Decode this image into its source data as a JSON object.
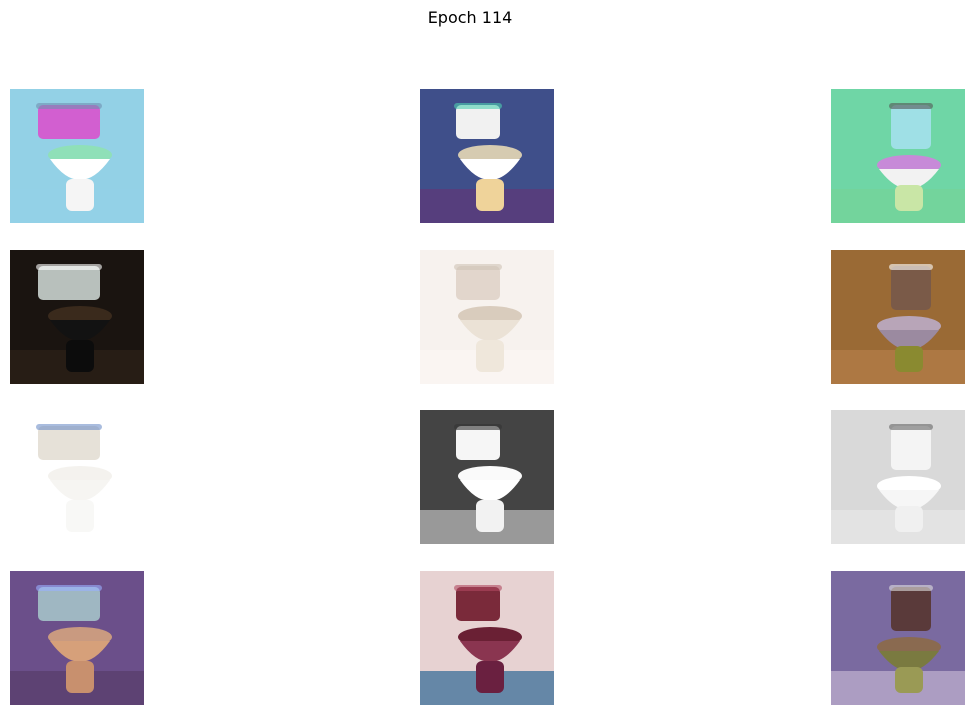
{
  "figure": {
    "title": "Epoch 114"
  },
  "grid": {
    "rows": 4,
    "cols": 3,
    "images": [
      {
        "name": "blue-bg-pink-tank",
        "bg": "#93d1e6",
        "tank": "#d25fd0",
        "lid": "#8fe0b8",
        "bowl": "#ffffff",
        "base": "#f5f5f5",
        "floor": "#93d1e6",
        "accent": "#6f8fb0"
      },
      {
        "name": "mosaic-bg-teal-lid",
        "bg": "#3f4f8a",
        "tank": "#f1f1f1",
        "lid": "#d6cbb1",
        "bowl": "#ffffff",
        "base": "#efd39a",
        "floor": "#5a3b7a",
        "accent": "#4fd1b0"
      },
      {
        "name": "green-bg-cyan-tank",
        "bg": "#6fd6a6",
        "tank": "#9fe0e6",
        "lid": "#c78ad8",
        "bowl": "#f2f2f2",
        "base": "#c9e6a6",
        "floor": "#74d49a",
        "accent": "#555555"
      },
      {
        "name": "dark-bg-black-bowl",
        "bg": "#1a1410",
        "tank": "#b8c0bc",
        "lid": "#3a2a1c",
        "bowl": "#121212",
        "base": "#0c0c0c",
        "floor": "#2a1e16",
        "accent": "#ffffff"
      },
      {
        "name": "white-bg-beige-toilet",
        "bg": "#f7f2ee",
        "tank": "#e2d6cc",
        "lid": "#d9ccbd",
        "bowl": "#ebe2d6",
        "base": "#efe7db",
        "floor": "#faf6f2",
        "accent": "#cfc3b6"
      },
      {
        "name": "brown-bg-glowing-toilet",
        "bg": "#9a6a35",
        "tank": "#7a5a48",
        "lid": "#b8a5b8",
        "bowl": "#9b8aa0",
        "base": "#8a8a30",
        "floor": "#b07a45",
        "accent": "#ffffff"
      },
      {
        "name": "white-bg-faded-toilet",
        "bg": "#ffffff",
        "tank": "#e6e1d8",
        "lid": "#f4f2ee",
        "bowl": "#f6f5f2",
        "base": "#f8f8f6",
        "floor": "#ffffff",
        "accent": "#6f8fc8"
      },
      {
        "name": "gray-tile-bg-white-toilet",
        "bg": "#444444",
        "tank": "#f6f6f6",
        "lid": "#fafafa",
        "bowl": "#ffffff",
        "base": "#f2f2f2",
        "floor": "#a8a8a8",
        "accent": "#333333"
      },
      {
        "name": "light-gray-bg-white-toilet",
        "bg": "#d9d9d9",
        "tank": "#f4f4f4",
        "lid": "#ffffff",
        "bowl": "#f6f6f6",
        "base": "#f0f0f0",
        "floor": "#e4e4e4",
        "accent": "#666666"
      },
      {
        "name": "purple-bg-orange-bowl",
        "bg": "#6b4f8a",
        "tank": "#9fb7c2",
        "lid": "#c99a80",
        "bowl": "#d6a07a",
        "base": "#c8906e",
        "floor": "#5a3f6e",
        "accent": "#9ab0ff"
      },
      {
        "name": "pink-bg-maroon-toilet",
        "bg": "#e7d2d2",
        "tank": "#7a2a3a",
        "lid": "#6a2034",
        "bowl": "#8a3550",
        "base": "#6a2040",
        "floor": "#4e7aa0",
        "accent": "#b04a60"
      },
      {
        "name": "purple-bg-olive-bowl",
        "bg": "#7a6aa0",
        "tank": "#5a3a3a",
        "lid": "#8a6a50",
        "bowl": "#7a7a40",
        "base": "#9a9a55",
        "floor": "#b5a6c8",
        "accent": "#e0e0e0"
      }
    ]
  }
}
